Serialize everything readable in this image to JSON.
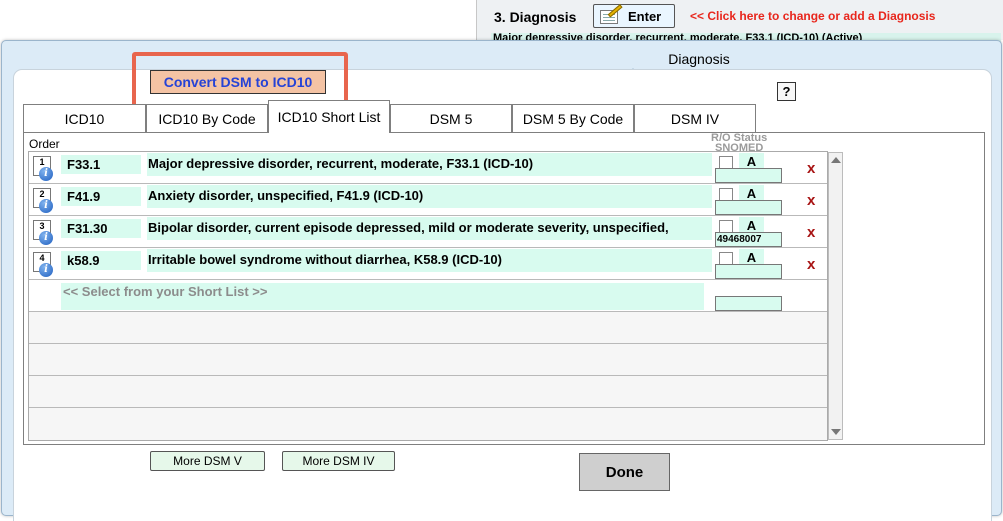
{
  "background": {
    "section_title": "3.  Diagnosis",
    "enter_label": "Enter",
    "hint": "<< Click here to change or add a Diagnosis",
    "active_diagnosis": "Major depressive disorder, recurrent, moderate, F33.1 (ICD-10) (Active)"
  },
  "modal": {
    "title": "Diagnosis",
    "convert_label": "Convert DSM to ICD10",
    "help_label": "?",
    "tabs": [
      {
        "label": "ICD10",
        "active": false
      },
      {
        "label": "ICD10 By Code",
        "active": false
      },
      {
        "label": "ICD10 Short List",
        "active": true
      },
      {
        "label": "DSM 5",
        "active": false
      },
      {
        "label": "DSM 5 By Code",
        "active": false
      },
      {
        "label": "DSM IV",
        "active": false
      }
    ],
    "order_label": "Order",
    "rostatus_label": "R/O Status",
    "snomed_label": "SNOMED",
    "rows": [
      {
        "order": "1",
        "code": "F33.1",
        "description": "Major depressive disorder, recurrent, moderate, F33.1 (ICD-10)",
        "status": "A",
        "snomed": ""
      },
      {
        "order": "2",
        "code": "F41.9",
        "description": "Anxiety disorder, unspecified, F41.9 (ICD-10)",
        "status": "A",
        "snomed": ""
      },
      {
        "order": "3",
        "code": "F31.30",
        "description": "Bipolar disorder, current episode depressed, mild or moderate severity, unspecified,",
        "status": "A",
        "snomed": "49468007"
      },
      {
        "order": "4",
        "code": "k58.9",
        "description": "Irritable bowel syndrome without diarrhea, K58.9 (ICD-10)",
        "status": "A",
        "snomed": ""
      }
    ],
    "delete_label": "x",
    "select_placeholder": "<< Select from your Short List >>",
    "more_dsm5_label": "More DSM V",
    "more_dsm4_label": "More DSM IV",
    "done_label": "Done"
  }
}
